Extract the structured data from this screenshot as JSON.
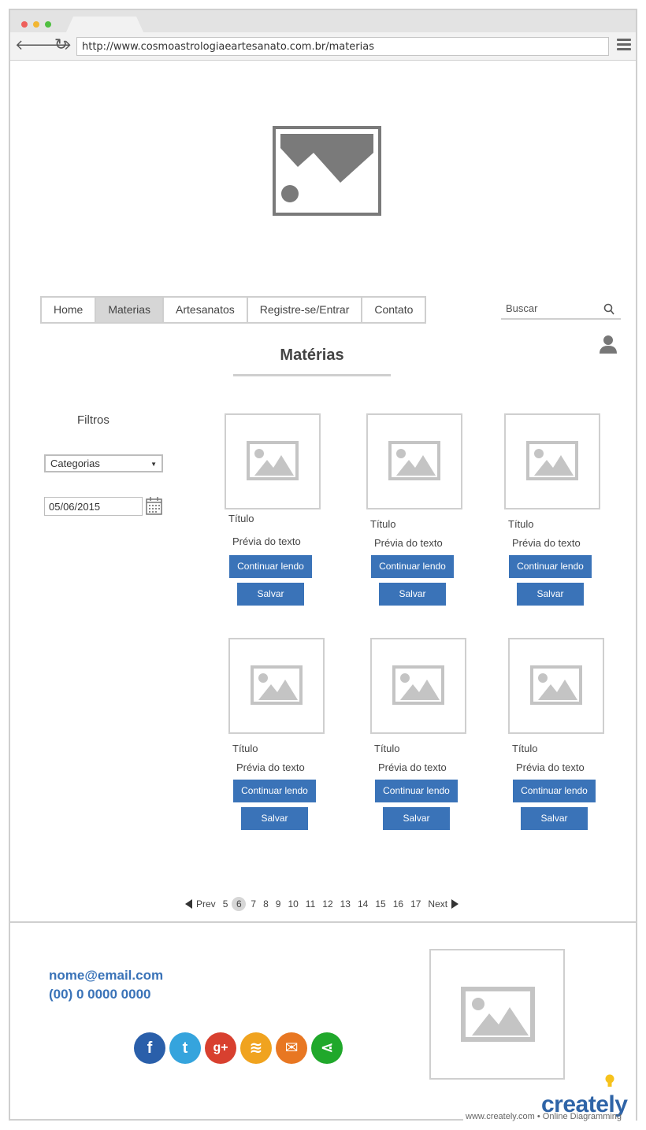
{
  "browser": {
    "url": "http://www.cosmoastrologiaeartesanato.com.br/materias"
  },
  "nav": {
    "items": [
      {
        "label": "Home",
        "active": false
      },
      {
        "label": "Materias",
        "active": true
      },
      {
        "label": "Artesanatos",
        "active": false
      },
      {
        "label": "Registre-se/Entrar",
        "active": false
      },
      {
        "label": "Contato",
        "active": false
      }
    ]
  },
  "search": {
    "placeholder": "Buscar"
  },
  "page": {
    "title": "Matérias"
  },
  "filters": {
    "label": "Filtros",
    "category_value": "Categorias",
    "date_value": "05/06/2015"
  },
  "cards": [
    {
      "title": "Título",
      "preview": "Prévia do texto",
      "read_label": "Continuar lendo",
      "save_label": "Salvar"
    },
    {
      "title": "Título",
      "preview": "Prévia do texto",
      "read_label": "Continuar lendo",
      "save_label": "Salvar"
    },
    {
      "title": "Título",
      "preview": "Prévia do texto",
      "read_label": "Continuar lendo",
      "save_label": "Salvar"
    },
    {
      "title": "Título",
      "preview": "Prévia do texto",
      "read_label": "Continuar lendo",
      "save_label": "Salvar"
    },
    {
      "title": "Título",
      "preview": "Prévia do texto",
      "read_label": "Continuar lendo",
      "save_label": "Salvar"
    },
    {
      "title": "Título",
      "preview": "Prévia do texto",
      "read_label": "Continuar lendo",
      "save_label": "Salvar"
    }
  ],
  "pagination": {
    "prev": "Prev",
    "next": "Next",
    "pages": [
      "5",
      "6",
      "7",
      "8",
      "9",
      "10",
      "11",
      "12",
      "13",
      "14",
      "15",
      "16",
      "17"
    ],
    "current": "6"
  },
  "footer": {
    "email": "nome@email.com",
    "phone": "(00) 0 0000 0000",
    "social": [
      {
        "icon": "facebook-icon",
        "glyph": "f",
        "color": "#2a5faa"
      },
      {
        "icon": "twitter-icon",
        "glyph": "t",
        "color": "#35a4dd"
      },
      {
        "icon": "google-plus-icon",
        "glyph": "g+",
        "color": "#d8402f"
      },
      {
        "icon": "rss-icon",
        "glyph": "≋",
        "color": "#f0a31f"
      },
      {
        "icon": "mail-icon",
        "glyph": "✉",
        "color": "#e87722"
      },
      {
        "icon": "share-icon",
        "glyph": "⋖",
        "color": "#20a82b"
      }
    ]
  },
  "watermark": {
    "logo": "creately",
    "tagline": "www.creately.com • Online Diagramming"
  }
}
